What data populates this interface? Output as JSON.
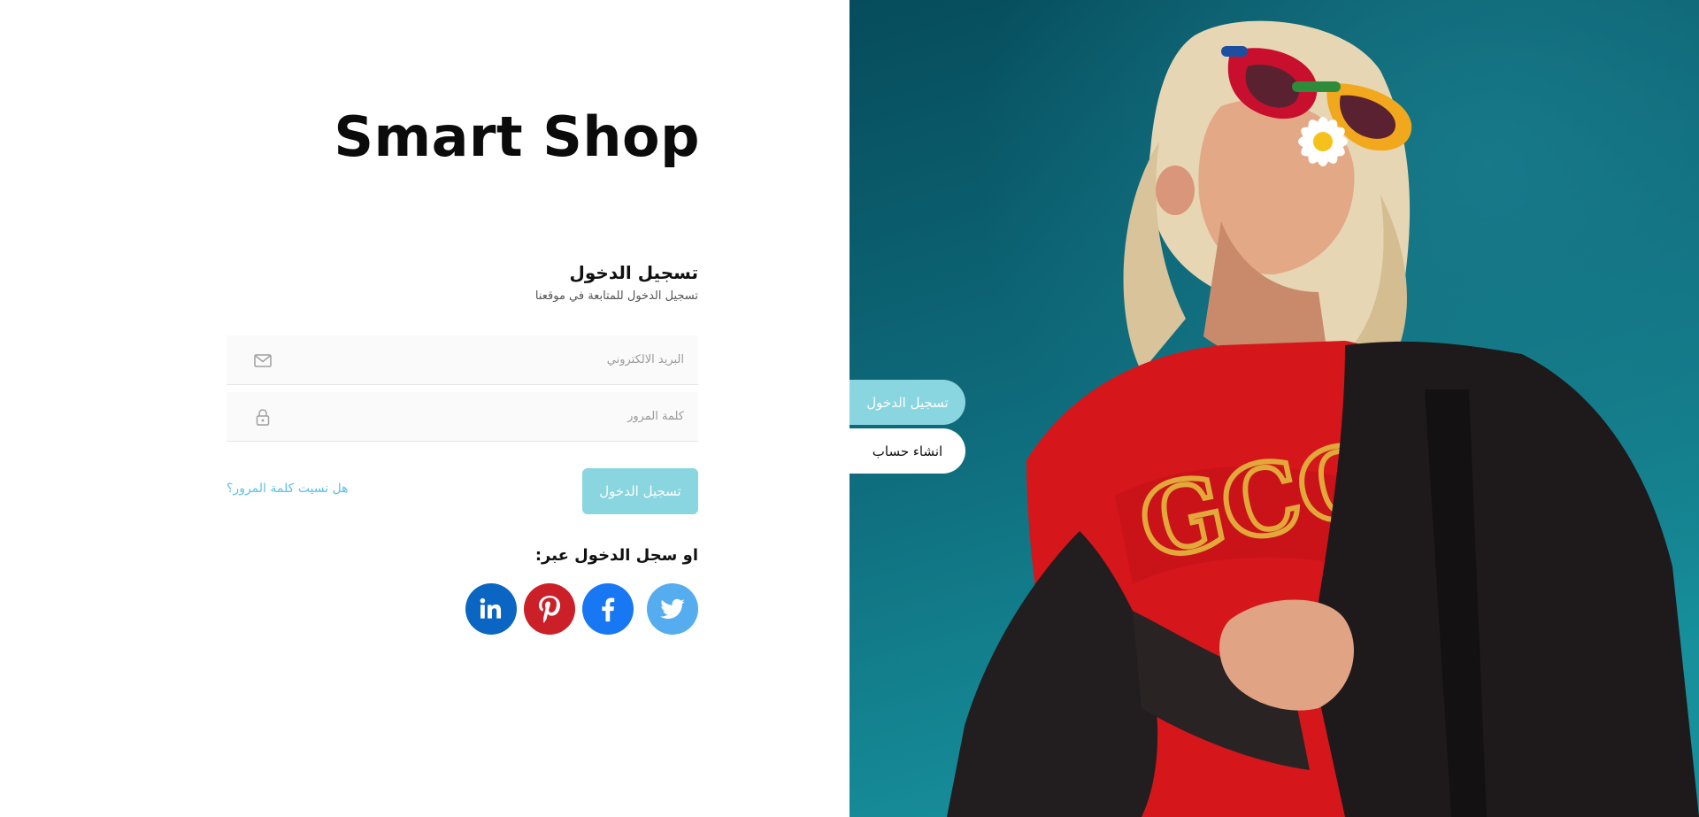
{
  "brand": {
    "title": "Smart Shop"
  },
  "login": {
    "title": "تسجيل الدخول",
    "subtitle": "تسجيل الدخول للمتابعة في موقعنا",
    "email": {
      "placeholder": "البريد الالكتروني",
      "value": "",
      "icon": "mail-icon"
    },
    "password": {
      "placeholder": "كلمة المرور",
      "value": "",
      "icon": "lock-icon"
    },
    "submit_label": "تسجيل الدخول",
    "forgot_label": "هل نسيت كلمة المرور؟"
  },
  "social": {
    "title": "او سجل الدخول عبر:",
    "networks": [
      {
        "name": "twitter",
        "icon": "twitter-icon",
        "color": "#55acee"
      },
      {
        "name": "facebook",
        "icon": "facebook-icon",
        "color": "#1877f2"
      },
      {
        "name": "pinterest",
        "icon": "pinterest-icon",
        "color": "#cb2027"
      },
      {
        "name": "linkedin",
        "icon": "linkedin-icon",
        "color": "#0a66c2"
      }
    ]
  },
  "tabs": {
    "login_label": "تسجيل الدخول",
    "register_label": "انشاء حساب"
  },
  "colors": {
    "accent": "#89d5e0",
    "link": "#5bc0e6",
    "photo_background": "#0e6a7a"
  }
}
